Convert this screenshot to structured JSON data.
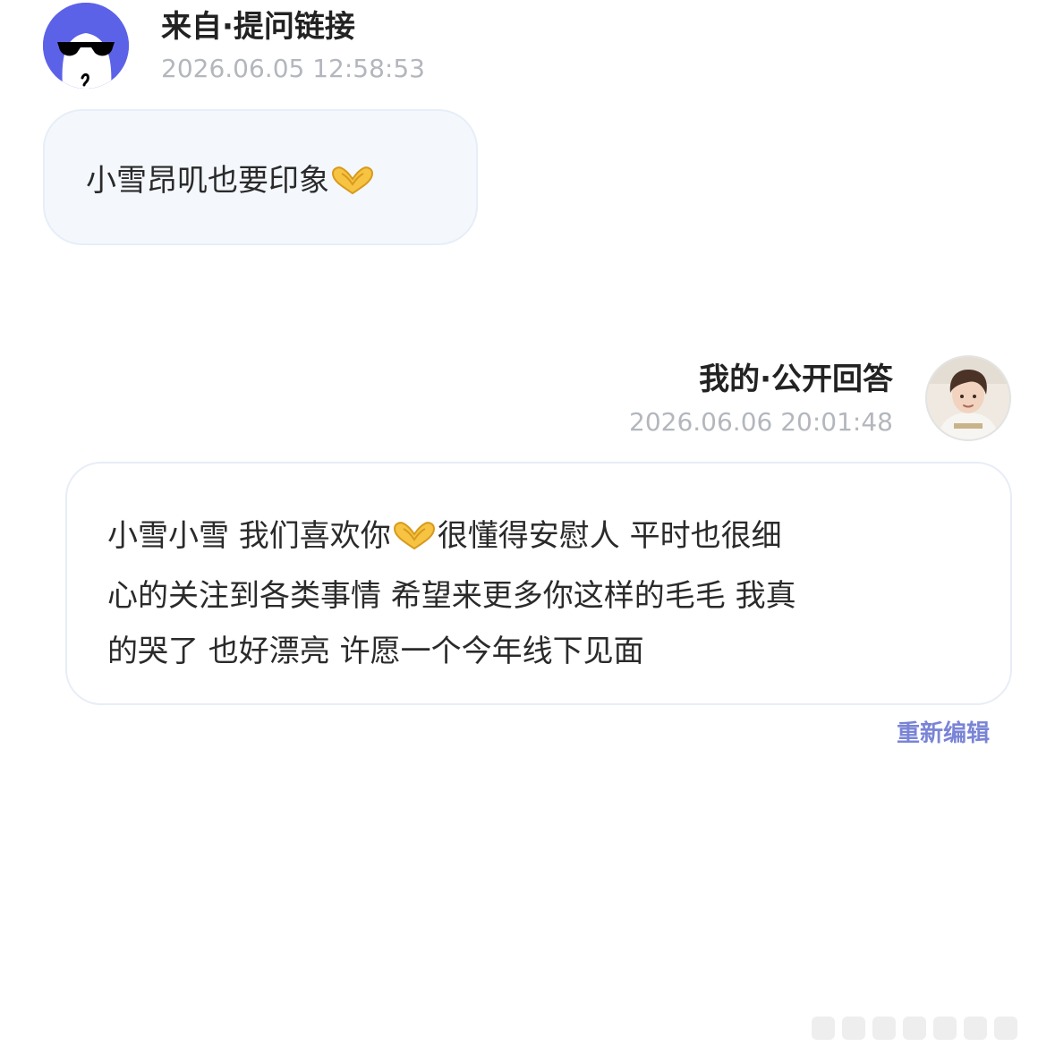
{
  "question": {
    "source_label": "来自·提问链接",
    "timestamp": "2026.06.05 12:58:53",
    "text": "小雪昂叽也要印象",
    "emoji": "heart-hands-emoji"
  },
  "answer": {
    "owner_label": "我的·公开回答",
    "timestamp": "2026.06.06 20:01:48",
    "lines": [
      {
        "before": "小雪小雪 我们喜欢你",
        "emoji": "heart-hands-emoji",
        "after": "很懂得安慰人 平时也很细"
      },
      {
        "text": "心的关注到各类事情 希望来更多你这样的毛毛 我真"
      },
      {
        "text": "的哭了 也好漂亮 许愿一个今年线下见面"
      }
    ],
    "edit_label": "重新编辑"
  },
  "colors": {
    "question_avatar_bg": "#5b62e8",
    "question_bubble_bg": "#f4f8fd",
    "edit_link": "#7a84d6",
    "timestamp": "#b3b7bd"
  }
}
